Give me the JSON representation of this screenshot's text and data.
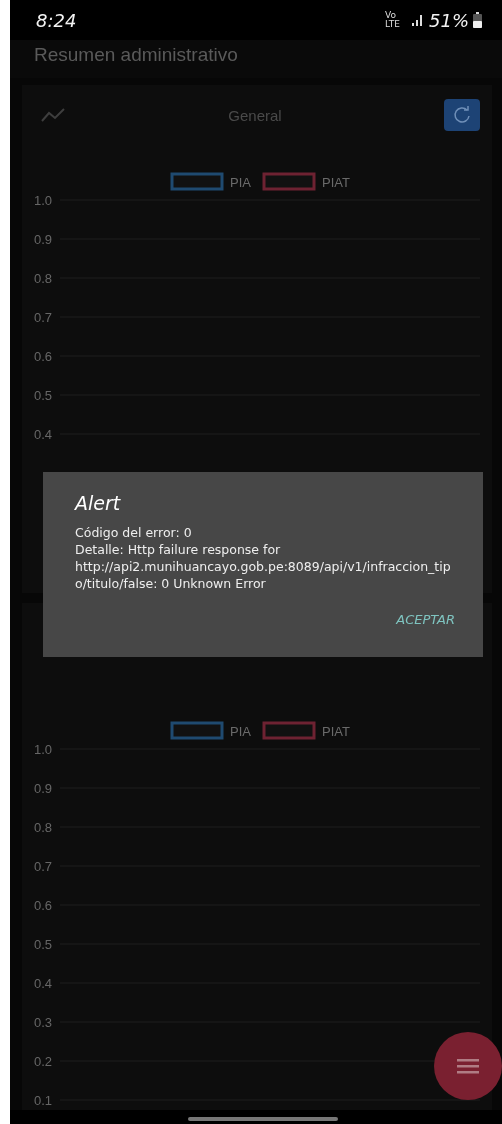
{
  "status_bar": {
    "time": "8:24",
    "network": "Vo LTE",
    "battery": "51%"
  },
  "page_title": "Resumen administrativo",
  "cards": [
    {
      "title": "General",
      "chart_data": {
        "type": "bar",
        "series": [
          {
            "name": "PIA",
            "color": "#1f4a70"
          },
          {
            "name": "PIAT",
            "color": "#6e2232"
          }
        ],
        "ylim": [
          0.4,
          1
        ],
        "grid": true,
        "yticks": [
          {
            "value": 1,
            "label": "1.0"
          },
          0.9,
          0.8,
          0.7,
          0.6,
          0.5,
          0.4
        ]
      }
    },
    {
      "chart_data": {
        "type": "bar",
        "series": [
          {
            "name": "PIA",
            "color": "#1f4a70"
          },
          {
            "name": "PIAT",
            "color": "#6e2232"
          }
        ],
        "ylim": [
          0,
          1
        ],
        "grid": true,
        "yticks": [
          {
            "value": 1,
            "label": "1.0"
          },
          0.9,
          0.8,
          0.7,
          0.6,
          0.5,
          0.4,
          0.3,
          0.2,
          0.1
        ]
      }
    }
  ],
  "dialog": {
    "title": "Alert",
    "lines": [
      "Código del error: 0",
      "Detalle: Http failure response for http://api2.munihuancayo.gob.pe:8089/api/v1/infraccion_tipo/titulo/false: 0 Unknown Error"
    ],
    "button": "ACEPTAR"
  }
}
